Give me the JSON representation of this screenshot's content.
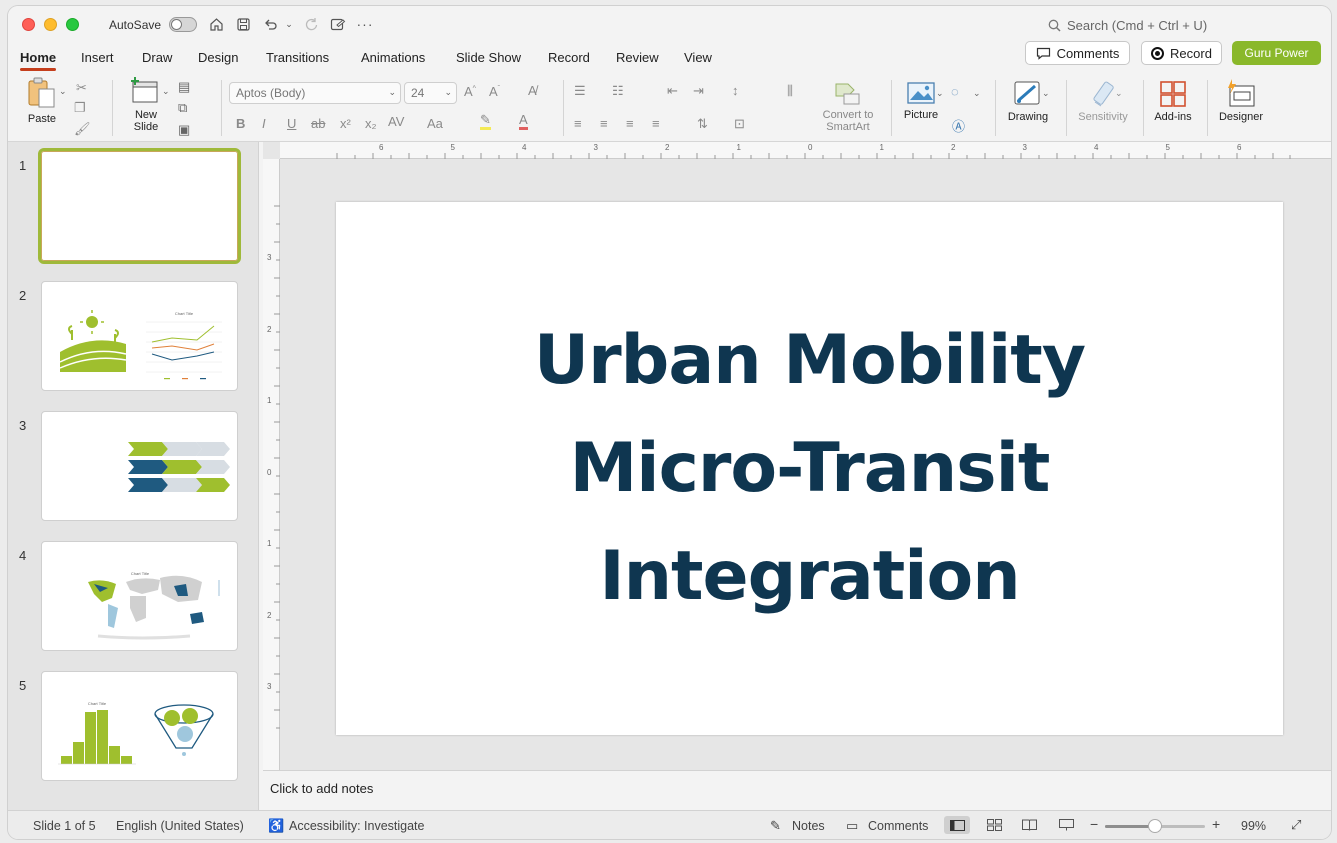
{
  "titlebar": {
    "autosave_label": "AutoSave",
    "search_placeholder": "Search (Cmd + Ctrl + U)"
  },
  "tabs": [
    {
      "label": "Home",
      "active": true
    },
    {
      "label": "Insert"
    },
    {
      "label": "Draw"
    },
    {
      "label": "Design"
    },
    {
      "label": "Transitions"
    },
    {
      "label": "Animations"
    },
    {
      "label": "Slide Show"
    },
    {
      "label": "Record"
    },
    {
      "label": "Review"
    },
    {
      "label": "View"
    }
  ],
  "top_buttons": {
    "comments": "Comments",
    "record": "Record",
    "guru": "Guru Power"
  },
  "ribbon": {
    "paste": "Paste",
    "new_slide_1": "New",
    "new_slide_2": "Slide",
    "font_name": "Aptos (Body)",
    "font_size": "24",
    "convert_1": "Convert to",
    "convert_2": "SmartArt",
    "picture": "Picture",
    "drawing": "Drawing",
    "sensitivity": "Sensitivity",
    "addins": "Add-ins",
    "designer": "Designer"
  },
  "slides": [
    "1",
    "2",
    "3",
    "4",
    "5"
  ],
  "thumbs": {
    "chart_title": "Chart Title"
  },
  "slide": {
    "title_line1": "Urban Mobility",
    "title_line2": "Micro-Transit",
    "title_line3": "Integration",
    "title_color": "#0f3650"
  },
  "notes_placeholder": "Click to add notes",
  "status": {
    "slide_info": "Slide 1 of 5",
    "language": "English (United States)",
    "accessibility": "Accessibility: Investigate",
    "notes": "Notes",
    "comments": "Comments",
    "zoom": "99%",
    "zoom_level": 0.5
  },
  "colors": {
    "accent_tab": "#c43e1c",
    "guru_green": "#8ab82a",
    "thumb_green": "#9fbf2e",
    "thumb_blue": "#1f5a80"
  }
}
